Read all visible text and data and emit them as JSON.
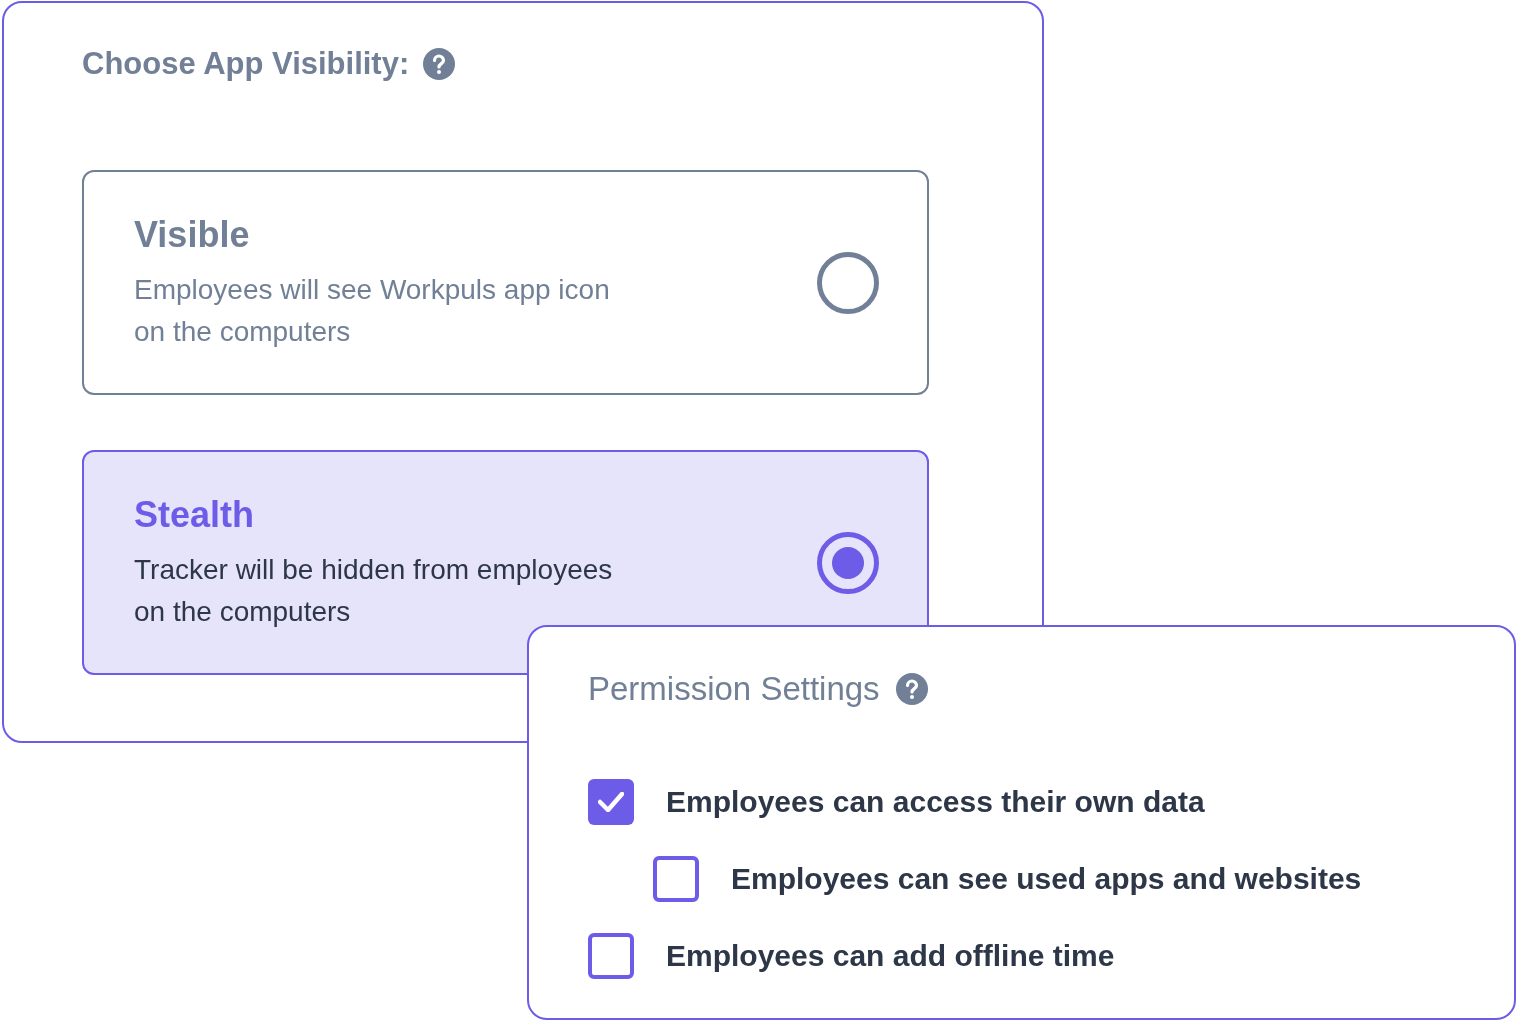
{
  "visibility_card": {
    "title": "Choose App Visibility:",
    "options": [
      {
        "title": "Visible",
        "description_lines": [
          "Employees will see Workpuls app icon",
          "on the computers"
        ],
        "selected": false
      },
      {
        "title": "Stealth",
        "description_lines": [
          "Tracker will be hidden from employees",
          "on the computers"
        ],
        "selected": true
      }
    ]
  },
  "permissions_card": {
    "title": "Permission Settings",
    "items": [
      {
        "label": "Employees can access their own data",
        "checked": true,
        "children": [
          {
            "label": "Employees can see used apps and websites",
            "checked": false
          }
        ]
      },
      {
        "label": "Employees can add offline time",
        "checked": false
      }
    ]
  }
}
